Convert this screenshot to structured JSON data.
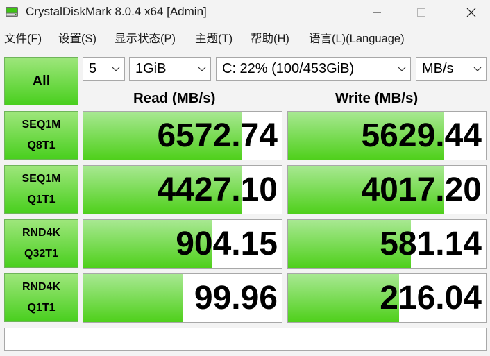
{
  "window": {
    "title": "CrystalDiskMark 8.0.4 x64 [Admin]"
  },
  "menu": [
    {
      "id": "file",
      "label": "文件(F)"
    },
    {
      "id": "settings",
      "label": "设置(S)"
    },
    {
      "id": "display",
      "label": "显示状态(P)"
    },
    {
      "id": "theme",
      "label": "主题(T)"
    },
    {
      "id": "help",
      "label": "帮助(H)"
    },
    {
      "id": "language",
      "label": "语言(L)(Language)"
    }
  ],
  "controls": {
    "all_label": "All",
    "count": "5",
    "size": "1GiB",
    "drive": "C: 22% (100/453GiB)",
    "unit": "MB/s"
  },
  "headers": {
    "read": "Read (MB/s)",
    "write": "Write (MB/s)"
  },
  "tests": [
    {
      "line1": "SEQ1M",
      "line2": "Q8T1",
      "read": "6572.74",
      "write": "5629.44",
      "read_fill": 0.8,
      "write_fill": 0.79
    },
    {
      "line1": "SEQ1M",
      "line2": "Q1T1",
      "read": "4427.10",
      "write": "4017.20",
      "read_fill": 0.8,
      "write_fill": 0.79
    },
    {
      "line1": "RND4K",
      "line2": "Q32T1",
      "read": "904.15",
      "write": "581.14",
      "read_fill": 0.65,
      "write_fill": 0.62
    },
    {
      "line1": "RND4K",
      "line2": "Q1T1",
      "read": "99.96",
      "write": "216.04",
      "read_fill": 0.5,
      "write_fill": 0.56
    }
  ],
  "comment": "",
  "colors": {
    "green_top": "#9ee67c",
    "green_bottom": "#49cf1e",
    "border": "#a8a8a8"
  },
  "icons": {
    "app": "crystaldiskmark-disk-icon",
    "dropdown": "chevron-down-icon"
  }
}
